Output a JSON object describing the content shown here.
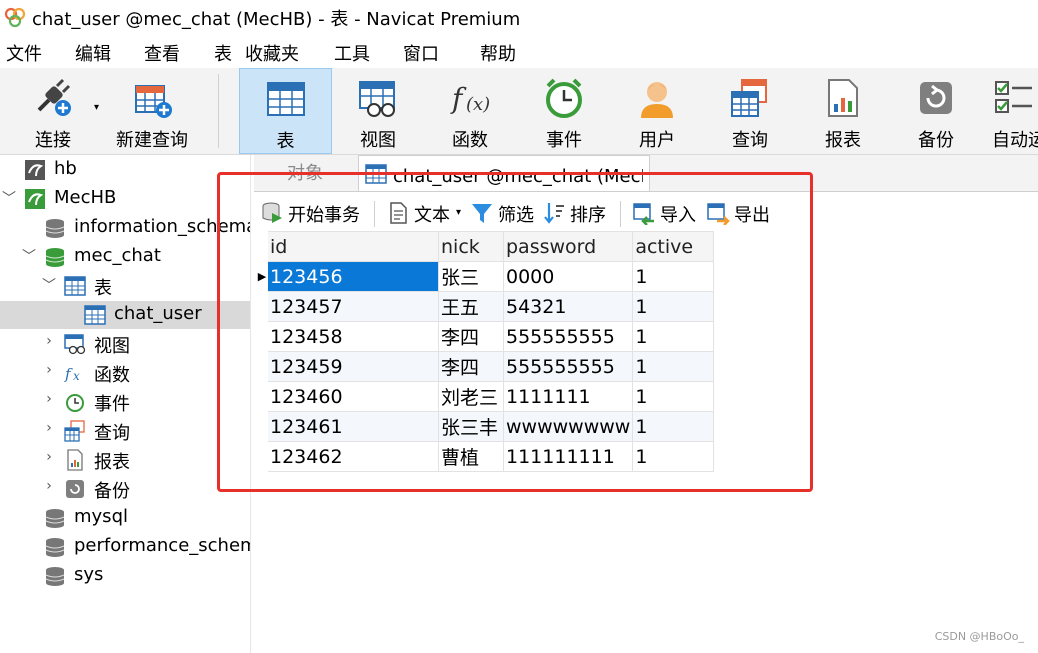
{
  "window": {
    "title": "chat_user @mec_chat (MecHB) - 表 - Navicat Premium"
  },
  "menu": [
    "文件",
    "编辑",
    "查看",
    "表",
    "收藏夹",
    "工具",
    "窗口",
    "帮助"
  ],
  "toolbar": {
    "connect": "连接",
    "new_query": "新建查询",
    "table": "表",
    "view": "视图",
    "function": "函数",
    "event": "事件",
    "user": "用户",
    "query": "查询",
    "report": "报表",
    "backup": "备份",
    "automation": "自动运"
  },
  "tree": {
    "hb": "hb",
    "mechb": "MecHB",
    "information_schema": "information_schema",
    "mec_chat": "mec_chat",
    "tables": "表",
    "chat_user": "chat_user",
    "views": "视图",
    "functions": "函数",
    "events": "事件",
    "queries": "查询",
    "reports": "报表",
    "backups": "备份",
    "mysql": "mysql",
    "performance_schema": "performance_schema",
    "sys": "sys"
  },
  "tabs": {
    "objects": "对象",
    "current": "chat_user @mec_chat (MecHB) - 表"
  },
  "subtoolbar": {
    "begin_transaction": "开始事务",
    "text": "文本",
    "filter": "筛选",
    "sort": "排序",
    "import": "导入",
    "export": "导出"
  },
  "table": {
    "columns": [
      "id",
      "nick",
      "password",
      "active"
    ],
    "rows": [
      [
        "123456",
        "张三",
        "0000",
        "1"
      ],
      [
        "123457",
        "王五",
        "54321",
        "1"
      ],
      [
        "123458",
        "李四",
        "555555555",
        "1"
      ],
      [
        "123459",
        "李四",
        "555555555",
        "1"
      ],
      [
        "123460",
        "刘老三",
        "1111111",
        "1"
      ],
      [
        "123461",
        "张三丰",
        "wwwwwwww",
        "1"
      ],
      [
        "123462",
        "曹植",
        "111111111",
        "1"
      ]
    ]
  },
  "watermark": "CSDN @HBoOo_",
  "colors": {
    "selected_row": "#0a78d7",
    "highlight_box": "#e8302a",
    "active_tool": "#cce4f7"
  }
}
